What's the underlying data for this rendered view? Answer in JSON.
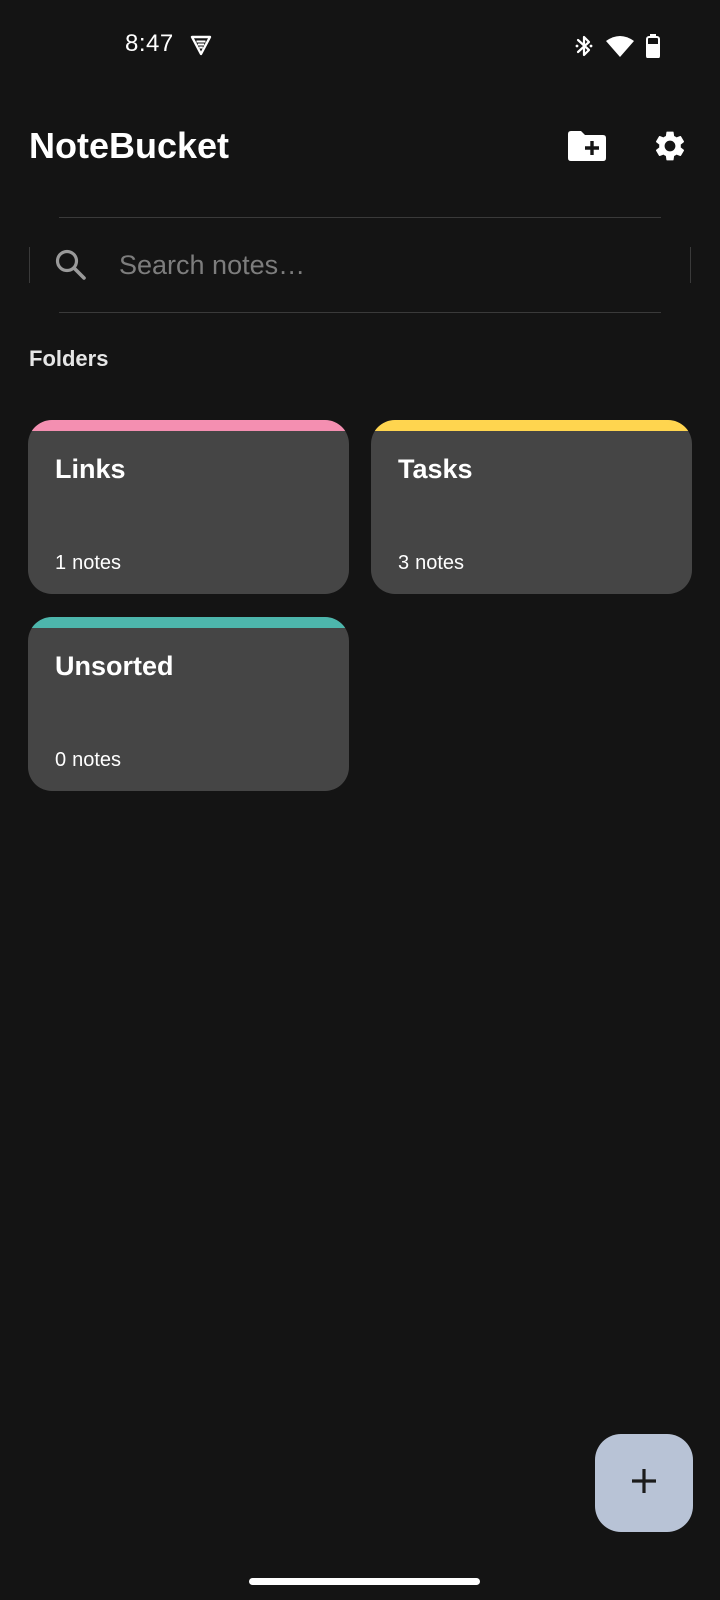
{
  "status_bar": {
    "time": "8:47",
    "icons": [
      "vpn-icon",
      "bluetooth-icon",
      "wifi-icon",
      "battery-icon"
    ]
  },
  "header": {
    "title": "NoteBucket",
    "actions": [
      "create-folder-icon",
      "settings-icon"
    ]
  },
  "search": {
    "placeholder": "Search notes…",
    "value": ""
  },
  "folders_section": {
    "label": "Folders",
    "notes_word": "notes",
    "items": [
      {
        "name": "Links",
        "count": "1",
        "accent_color": "#f48fb1"
      },
      {
        "name": "Tasks",
        "count": "3",
        "accent_color": "#ffd54f"
      },
      {
        "name": "Unsorted",
        "count": "0",
        "accent_color": "#4db6ac"
      }
    ]
  },
  "fab": {
    "icon": "add-icon",
    "background_color": "#b8c3d6"
  },
  "colors": {
    "background": "#141414",
    "card": "#454545",
    "text": "#ffffff",
    "placeholder": "#7d7d7d"
  }
}
